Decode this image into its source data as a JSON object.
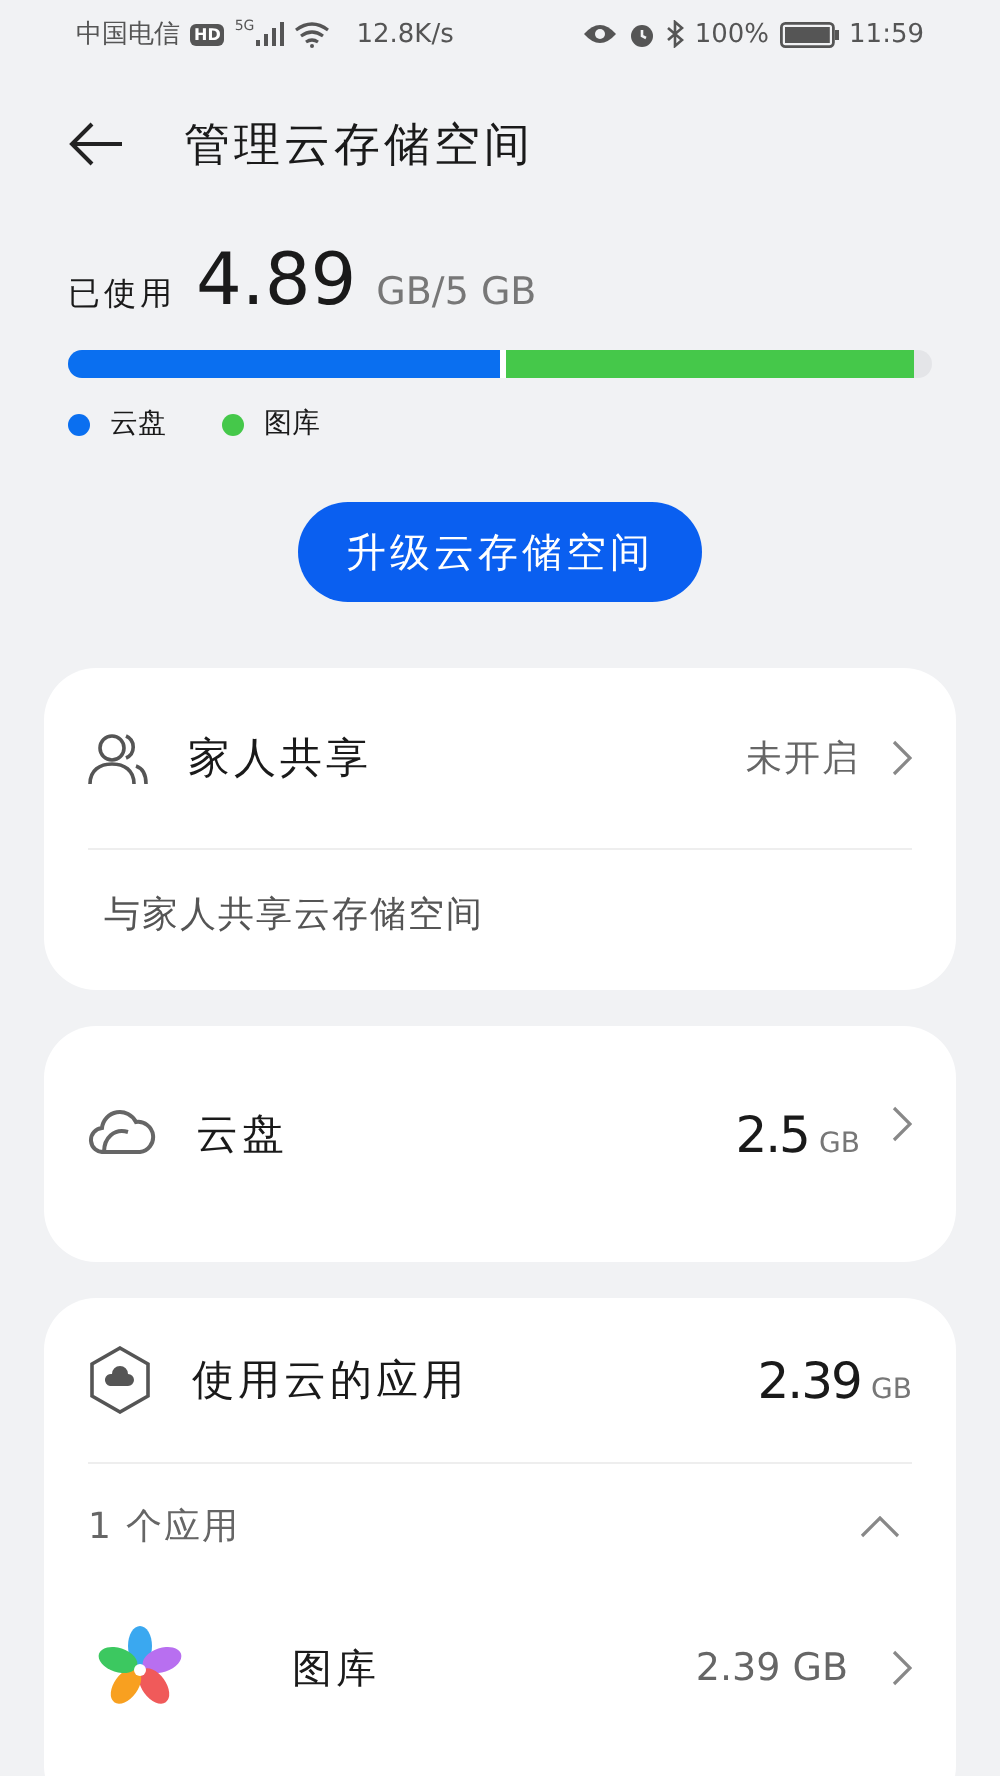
{
  "status_bar": {
    "carrier": "中国电信",
    "hd": "HD",
    "network": "5G",
    "speed": "12.8K/s",
    "battery": "100%",
    "time": "11:59"
  },
  "header": {
    "title": "管理云存储空间"
  },
  "usage": {
    "label": "已使用",
    "amount": "4.89",
    "unit": "GB/5 GB",
    "segments": [
      {
        "name": "云盘",
        "color": "#0a6ff0"
      },
      {
        "name": "图库",
        "color": "#45c84a"
      }
    ]
  },
  "upgrade_button": "升级云存储空间",
  "family_card": {
    "title": "家人共享",
    "status": "未开启",
    "description": "与家人共享云存储空间"
  },
  "drive_card": {
    "title": "云盘",
    "size": "2.5",
    "unit": "GB"
  },
  "apps_card": {
    "title": "使用云的应用",
    "size": "2.39",
    "unit": "GB",
    "count": "1 个应用",
    "expanded": true,
    "apps": [
      {
        "name": "图库",
        "size": "2.39 GB"
      }
    ]
  }
}
